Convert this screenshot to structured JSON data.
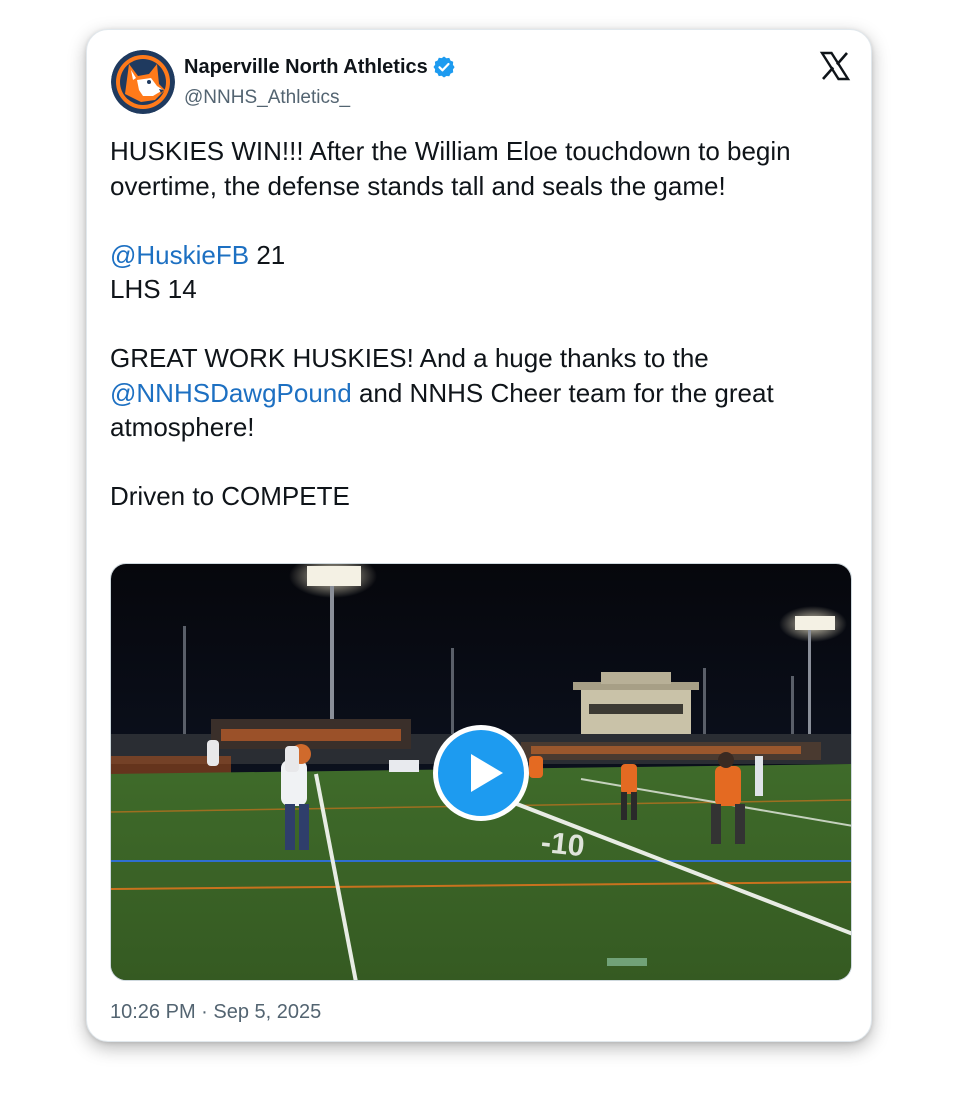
{
  "author": {
    "display_name": "Naperville North Athletics",
    "handle": "@NNHS_Athletics_",
    "verified": true,
    "avatar_icon": "husky-logo-icon"
  },
  "platform_icon": "x-logo-icon",
  "tweet": {
    "line1": "HUSKIES WIN!!!  After the William Eloe touchdown to begin overtime, the defense stands tall and seals the game!",
    "score_mention": "@HuskieFB",
    "score_home": " 21",
    "score_away": "LHS 14",
    "thanks_text": "GREAT WORK HUSKIES!  And a huge thanks to the",
    "thanks_mention": "@NNHSDawgPound",
    "thanks_rest": " and NNHS Cheer team for the great atmosphere!",
    "closing": "Driven to COMPETE"
  },
  "media": {
    "type": "video",
    "play_icon": "play-icon"
  },
  "timestamp": "10:26 PM · Sep 5, 2025",
  "colors": {
    "link": "#1d70c2",
    "play_button": "#1d9bf0",
    "verified_badge": "#1d9bf0",
    "secondary_text": "#536471"
  }
}
